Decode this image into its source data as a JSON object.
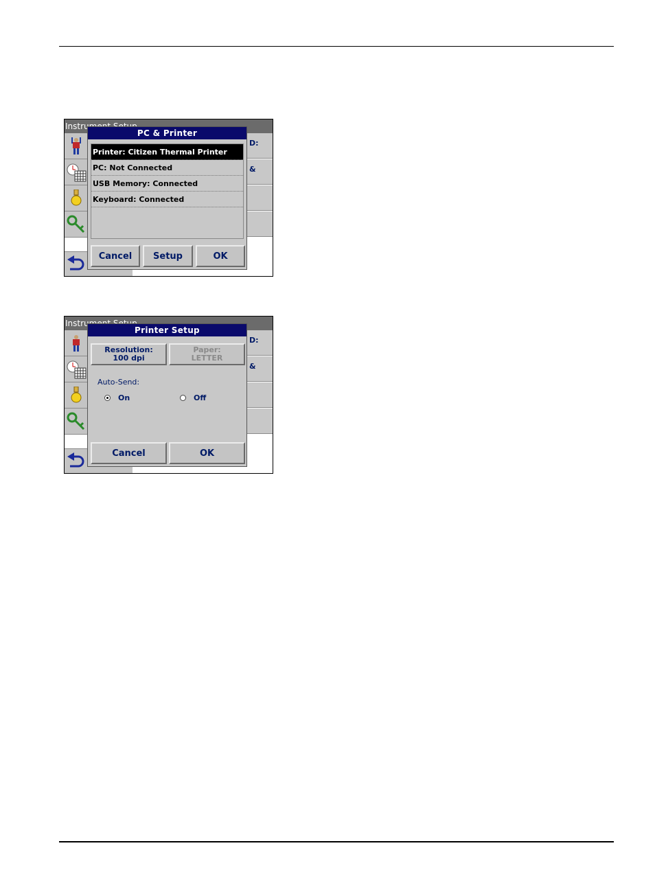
{
  "screen1": {
    "background": {
      "header": "Instrument Setup",
      "right_labels": [
        "D:",
        "&",
        "",
        ""
      ]
    },
    "dialog": {
      "title": "PC & Printer",
      "items": [
        "Printer: Citizen Thermal Printer",
        "PC: Not Connected",
        "USB Memory: Connected",
        "Keyboard: Connected"
      ],
      "selected_index": 0,
      "buttons": {
        "cancel": "Cancel",
        "setup": "Setup",
        "ok": "OK"
      }
    }
  },
  "screen2": {
    "background": {
      "header": "Instrument Setup",
      "right_labels": [
        "D:",
        "&",
        "",
        ""
      ]
    },
    "dialog": {
      "title": "Printer Setup",
      "resolution_label": "Resolution:",
      "resolution_value": "100 dpi",
      "paper_label": "Paper:",
      "paper_value": "LETTER",
      "auto_send_label": "Auto-Send:",
      "options": [
        "On",
        "Off"
      ],
      "selected_option": "On",
      "buttons": {
        "cancel": "Cancel",
        "ok": "OK"
      }
    }
  },
  "colors": {
    "title_bar": "#0a0a6b",
    "button_text": "#001a66",
    "header_bg": "#6b6b6b"
  },
  "icons": [
    "user-icon",
    "clock-calendar-icon",
    "lamp-icon",
    "key-icon",
    "back-arrow-icon"
  ]
}
